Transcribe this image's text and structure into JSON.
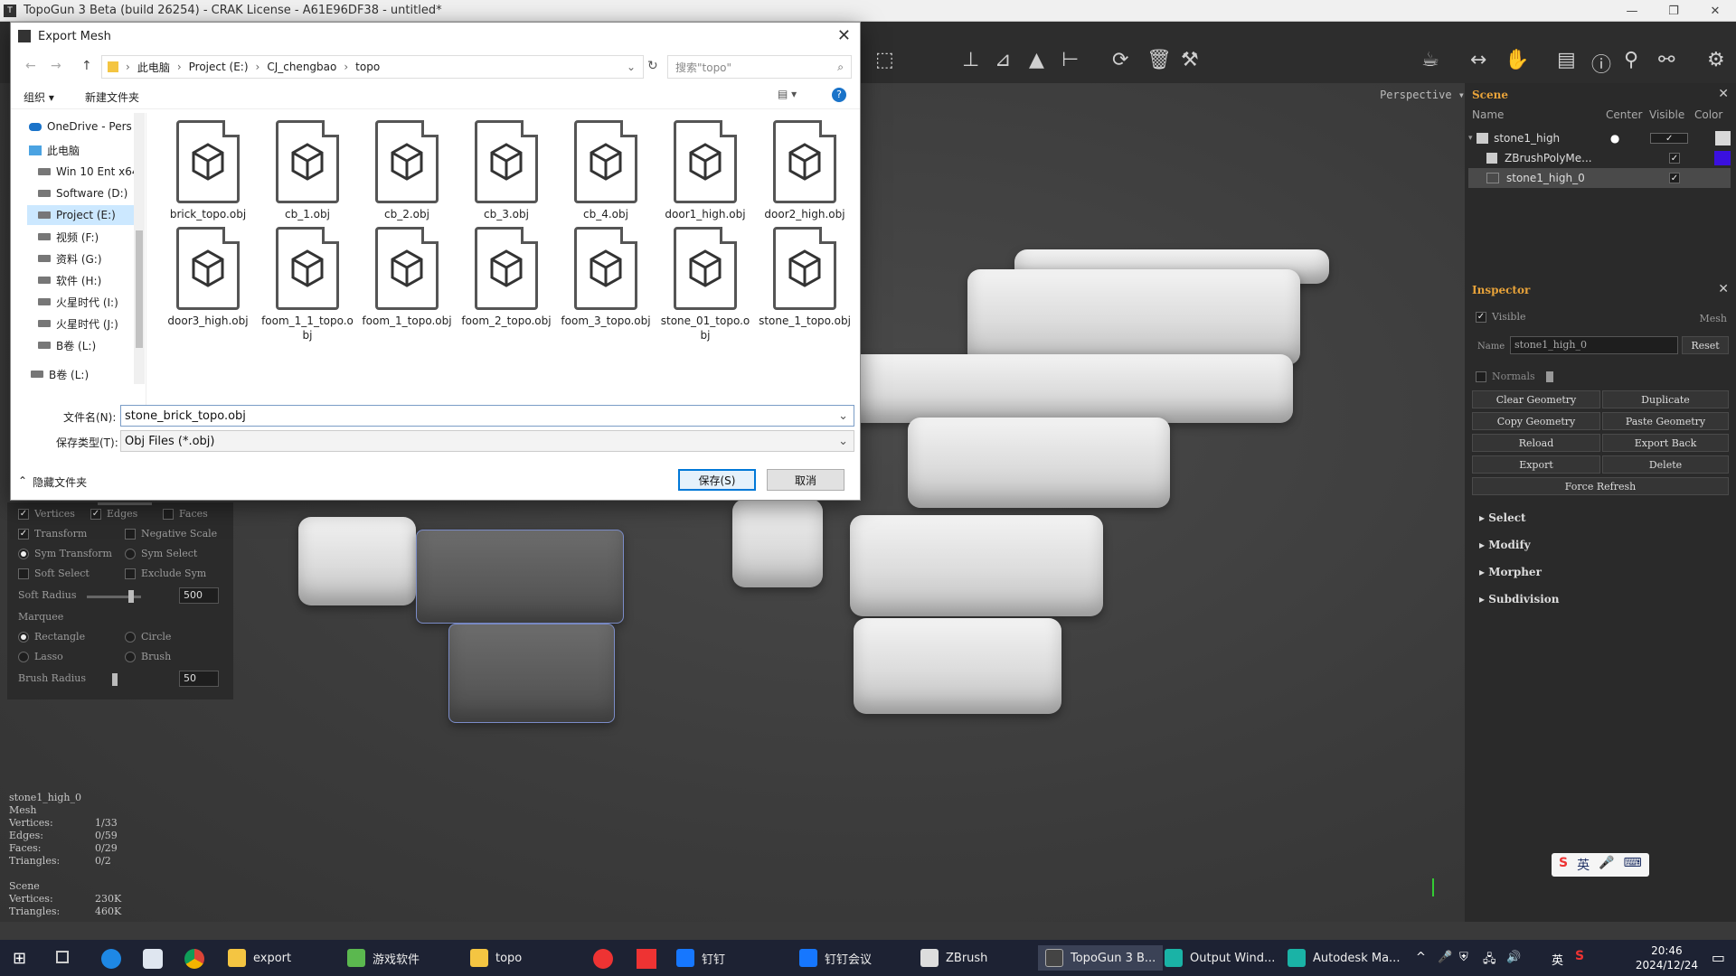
{
  "app": {
    "title": "TopoGun 3 Beta (build 26254) - CRAK License - A61E96DF38 - untitled*",
    "win_min": "—",
    "win_max": "❐",
    "win_close": "✕"
  },
  "viewport": {
    "camera_label": "Perspective ▾"
  },
  "options_panel": {
    "vertices": "Vertices",
    "edges": "Edges",
    "faces": "Faces",
    "transform": "Transform",
    "negative_scale": "Negative Scale",
    "sym_transform": "Sym Transform",
    "sym_select": "Sym Select",
    "soft_select": "Soft Select",
    "exclude_sym": "Exclude Sym",
    "soft_radius": "Soft Radius",
    "soft_radius_value": "500",
    "marquee": "Marquee",
    "rectangle": "Rectangle",
    "circle": "Circle",
    "lasso": "Lasso",
    "brush": "Brush",
    "brush_radius": "Brush Radius",
    "brush_radius_value": "50"
  },
  "stats": {
    "object": "stone1_high_0",
    "type": "Mesh",
    "rows": [
      {
        "k": "Vertices:",
        "v": "1/33"
      },
      {
        "k": "Edges:",
        "v": "0/59"
      },
      {
        "k": "Faces:",
        "v": "0/29"
      },
      {
        "k": "Triangles:",
        "v": "0/2"
      }
    ],
    "scene_label": "Scene",
    "scene_rows": [
      {
        "k": "Vertices:",
        "v": "230K"
      },
      {
        "k": "Triangles:",
        "v": "460K"
      }
    ]
  },
  "scene_panel": {
    "title": "Scene",
    "col_name": "Name",
    "col_center": "Center",
    "col_visible": "Visible",
    "col_color": "Color",
    "items": [
      {
        "name": "stone1_high",
        "color": "#d8d8d8"
      },
      {
        "name": "ZBrushPolyMe...",
        "color": "#3a10e0"
      },
      {
        "name": "stone1_high_0",
        "color": ""
      }
    ]
  },
  "inspector": {
    "title": "Inspector",
    "visible": "Visible",
    "mesh": "Mesh",
    "name_label": "Name",
    "name_value": "stone1_high_0",
    "reset": "Reset",
    "normals": "Normals",
    "buttons": [
      "Clear Geometry",
      "Duplicate",
      "Copy Geometry",
      "Paste Geometry",
      "Reload",
      "Export Back",
      "Export",
      "Delete"
    ],
    "force_refresh": "Force Refresh",
    "sections": [
      "Select",
      "Modify",
      "Morpher",
      "Subdivision"
    ]
  },
  "dialog": {
    "title": "Export Mesh",
    "close": "✕",
    "breadcrumb": [
      "此电脑",
      "Project (E:)",
      "CJ_chengbao",
      "topo"
    ],
    "search_placeholder": "搜索\"topo\"",
    "organize": "组织 ▾",
    "new_folder": "新建文件夹",
    "nav": [
      "OneDrive - Pers",
      "此电脑",
      "Win 10 Ent x64",
      "Software (D:)",
      "Project (E:)",
      "视频 (F:)",
      "资料 (G:)",
      "软件 (H:)",
      "火星时代 (I:)",
      "火星时代 (J:)",
      "B卷 (L:)",
      "B卷 (L:)"
    ],
    "files": [
      "brick_topo.obj",
      "cb_1.obj",
      "cb_2.obj",
      "cb_3.obj",
      "cb_4.obj",
      "door1_high.obj",
      "door2_high.obj",
      "door3_high.obj",
      "foom_1_1_topo.obj",
      "foom_1_topo.obj",
      "foom_2_topo.obj",
      "foom_3_topo.obj",
      "stone_01_topo.obj",
      "stone_1_topo.obj"
    ],
    "filename_label": "文件名(N):",
    "filename_value": "stone_brick_topo.obj",
    "filetype_label": "保存类型(T):",
    "filetype_value": "Obj Files (*.obj)",
    "hide_folders": "隐藏文件夹",
    "save": "保存(S)",
    "cancel": "取消"
  },
  "taskbar": {
    "items": [
      "export",
      "游戏软件",
      "topo",
      "钉钉",
      "钉钉会议",
      "ZBrush",
      "TopoGun 3 B...",
      "Output Wind...",
      "Autodesk Ma..."
    ],
    "time": "20:46",
    "date": "2024/12/24",
    "ime": "英"
  }
}
